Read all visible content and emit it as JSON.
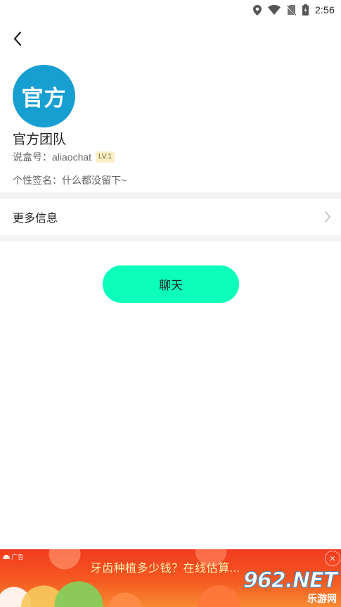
{
  "status_bar": {
    "time": "2:56",
    "icons": [
      "location-icon",
      "wifi-icon",
      "no-sim-icon",
      "battery-icon"
    ]
  },
  "header": {
    "back_icon": "chevron-left-icon"
  },
  "profile": {
    "avatar_text": "官方",
    "avatar_color": "#179fd2",
    "name": "官方团队",
    "id_label": "说盒号：",
    "id_value": "aliaochat",
    "level": "LV.1",
    "signature_label": "个性签名：",
    "signature_value": "什么都没留下~"
  },
  "more_info": {
    "label": "更多信息",
    "icon": "chevron-right-icon"
  },
  "chat_button": {
    "label": "聊天",
    "color": "#0cfebb"
  },
  "ad": {
    "tag": "广告",
    "title": "牙齿种植多少钱？在线估算...",
    "close_icon": "close-icon"
  },
  "watermark": {
    "main": "962.NET",
    "sub": "乐游网"
  }
}
